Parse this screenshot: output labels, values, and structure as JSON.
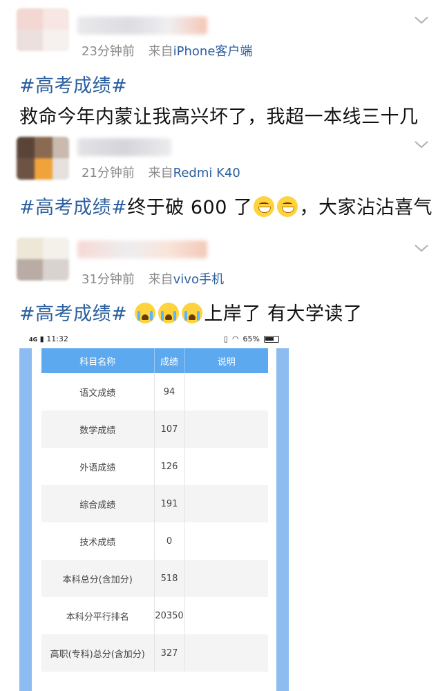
{
  "posts": [
    {
      "time": "23分钟前",
      "from": "来自",
      "client": "iPhone客户端",
      "tag": "#高考成绩#",
      "text": "救命今年内蒙让我高兴坏了，我超一本线三十几"
    },
    {
      "time": "21分钟前",
      "from": "来自",
      "client": "Redmi K40",
      "tag": "#高考成绩#",
      "text_before": "终于破 600 了",
      "emoji": [
        "grinning-emoji",
        "grinning-emoji"
      ],
      "text_after": "，大家沾沾喜气"
    },
    {
      "time": "31分钟前",
      "from": "来自",
      "client": "vivo手机",
      "tag": "#高考成绩#",
      "emoji": [
        "crying-emoji",
        "crying-emoji",
        "crying-emoji"
      ],
      "text_after": "上岸了 有大学读了"
    }
  ],
  "phone": {
    "status_time": "11:32",
    "signal": "4G",
    "battery": "65%",
    "table": {
      "headers": [
        "科目名称",
        "成绩",
        "说明"
      ],
      "rows": [
        [
          "语文成绩",
          "94",
          ""
        ],
        [
          "数学成绩",
          "107",
          ""
        ],
        [
          "外语成绩",
          "126",
          ""
        ],
        [
          "综合成绩",
          "191",
          ""
        ],
        [
          "技术成绩",
          "0",
          ""
        ],
        [
          "本科总分(含加分)",
          "518",
          ""
        ],
        [
          "本科分平行排名",
          "20350",
          ""
        ],
        [
          "高职(专科)总分(含加分)",
          "327",
          ""
        ]
      ]
    }
  },
  "colors": {
    "link": "#2b5f9e",
    "meta": "#8a8a8a",
    "table_header": "#5da9f0",
    "side_bar": "#8cbcf0"
  }
}
